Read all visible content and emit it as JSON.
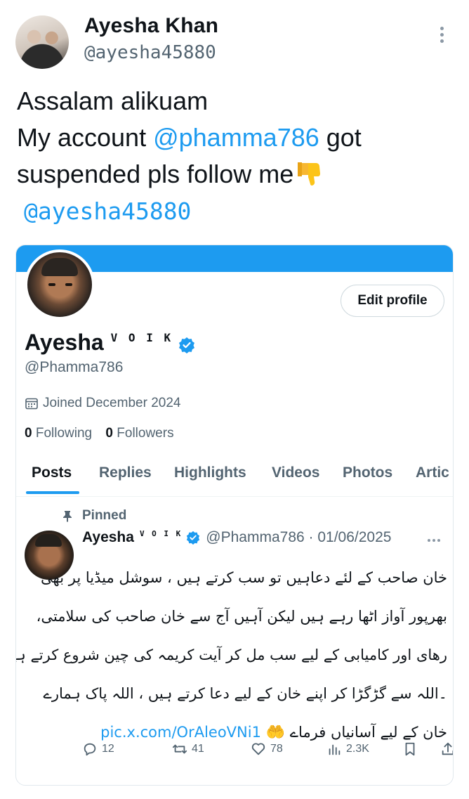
{
  "tweet": {
    "author_name": "Ayesha Khan",
    "author_handle": "@ayesha45880",
    "text_line1": "Assalam alikuam",
    "text_line2_pre": "My account ",
    "text_line2_mention": "@phamma786",
    "text_line2_post": " got",
    "text_line3": "suspended pls follow me",
    "text_line4_mention": "@ayesha45880",
    "emoji": "thumbs-down",
    "more_icon": "vertical-dots-icon"
  },
  "profile_card": {
    "name": "Ayesha",
    "name_tag": "V O I K",
    "handle": "@Phamma786",
    "joined": "Joined December 2024",
    "following_count": "0",
    "following_label": "Following",
    "followers_count": "0",
    "followers_label": "Followers",
    "edit_button": "Edit profile",
    "tabs": [
      "Posts",
      "Replies",
      "Highlights",
      "Videos",
      "Photos",
      "Artic"
    ],
    "active_tab": "Posts",
    "accent_color": "#1d9bf0"
  },
  "pinned_post": {
    "pinned_label": "Pinned",
    "name": "Ayesha",
    "name_tag": "V O I K",
    "handle_date": "@Phamma786 · 01/06/2025",
    "urdu_lines": [
      "خان صاحب کے لئے دعاہیں تو سب کرتے ہیں ، سوشل میڈیا پر بھی",
      "بھرپور آواز اٹھا رہے ہیں لیکن آہیں آج سے خان صاحب کی سلامتی،",
      "رھای اور کامیابی کے لیے سب مل کر آیت کریمہ کی چین شروع کرتے ہیں",
      "۔اللہ سے گڑگڑا کر اپنے خان کے لیے دعا کرتے ہیں ، اللہ پاک ہمارے",
      "خان کے لیے آسانیاں فرماے"
    ],
    "link": "pic.x.com/OrAleoVNi1",
    "hands_emoji": "🤲",
    "replies": "12",
    "reposts": "41",
    "likes": "78",
    "views": "2.3K"
  }
}
